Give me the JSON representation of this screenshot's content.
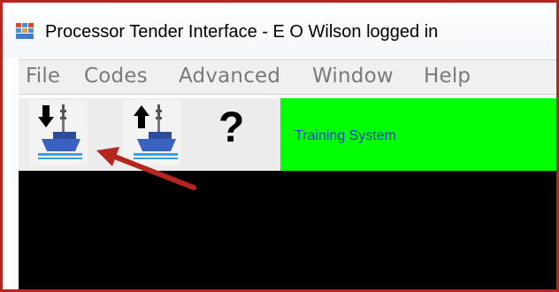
{
  "window": {
    "title": "Processor Tender Interface - E O Wilson logged in"
  },
  "menubar": {
    "items": [
      "File",
      "Codes",
      "Advanced",
      "Window",
      "Help"
    ]
  },
  "toolbar": {
    "buttons": [
      {
        "icon": "download-boat-icon"
      },
      {
        "icon": "upload-boat-icon"
      },
      {
        "icon": "help-icon",
        "label": "?"
      }
    ],
    "status_label": "Training System",
    "status_color": "#00ff00"
  },
  "colors": {
    "frame": "#b5261e",
    "annotation_arrow": "#b5261e",
    "content_bg": "#000000",
    "status_text": "#1c3fd6"
  }
}
